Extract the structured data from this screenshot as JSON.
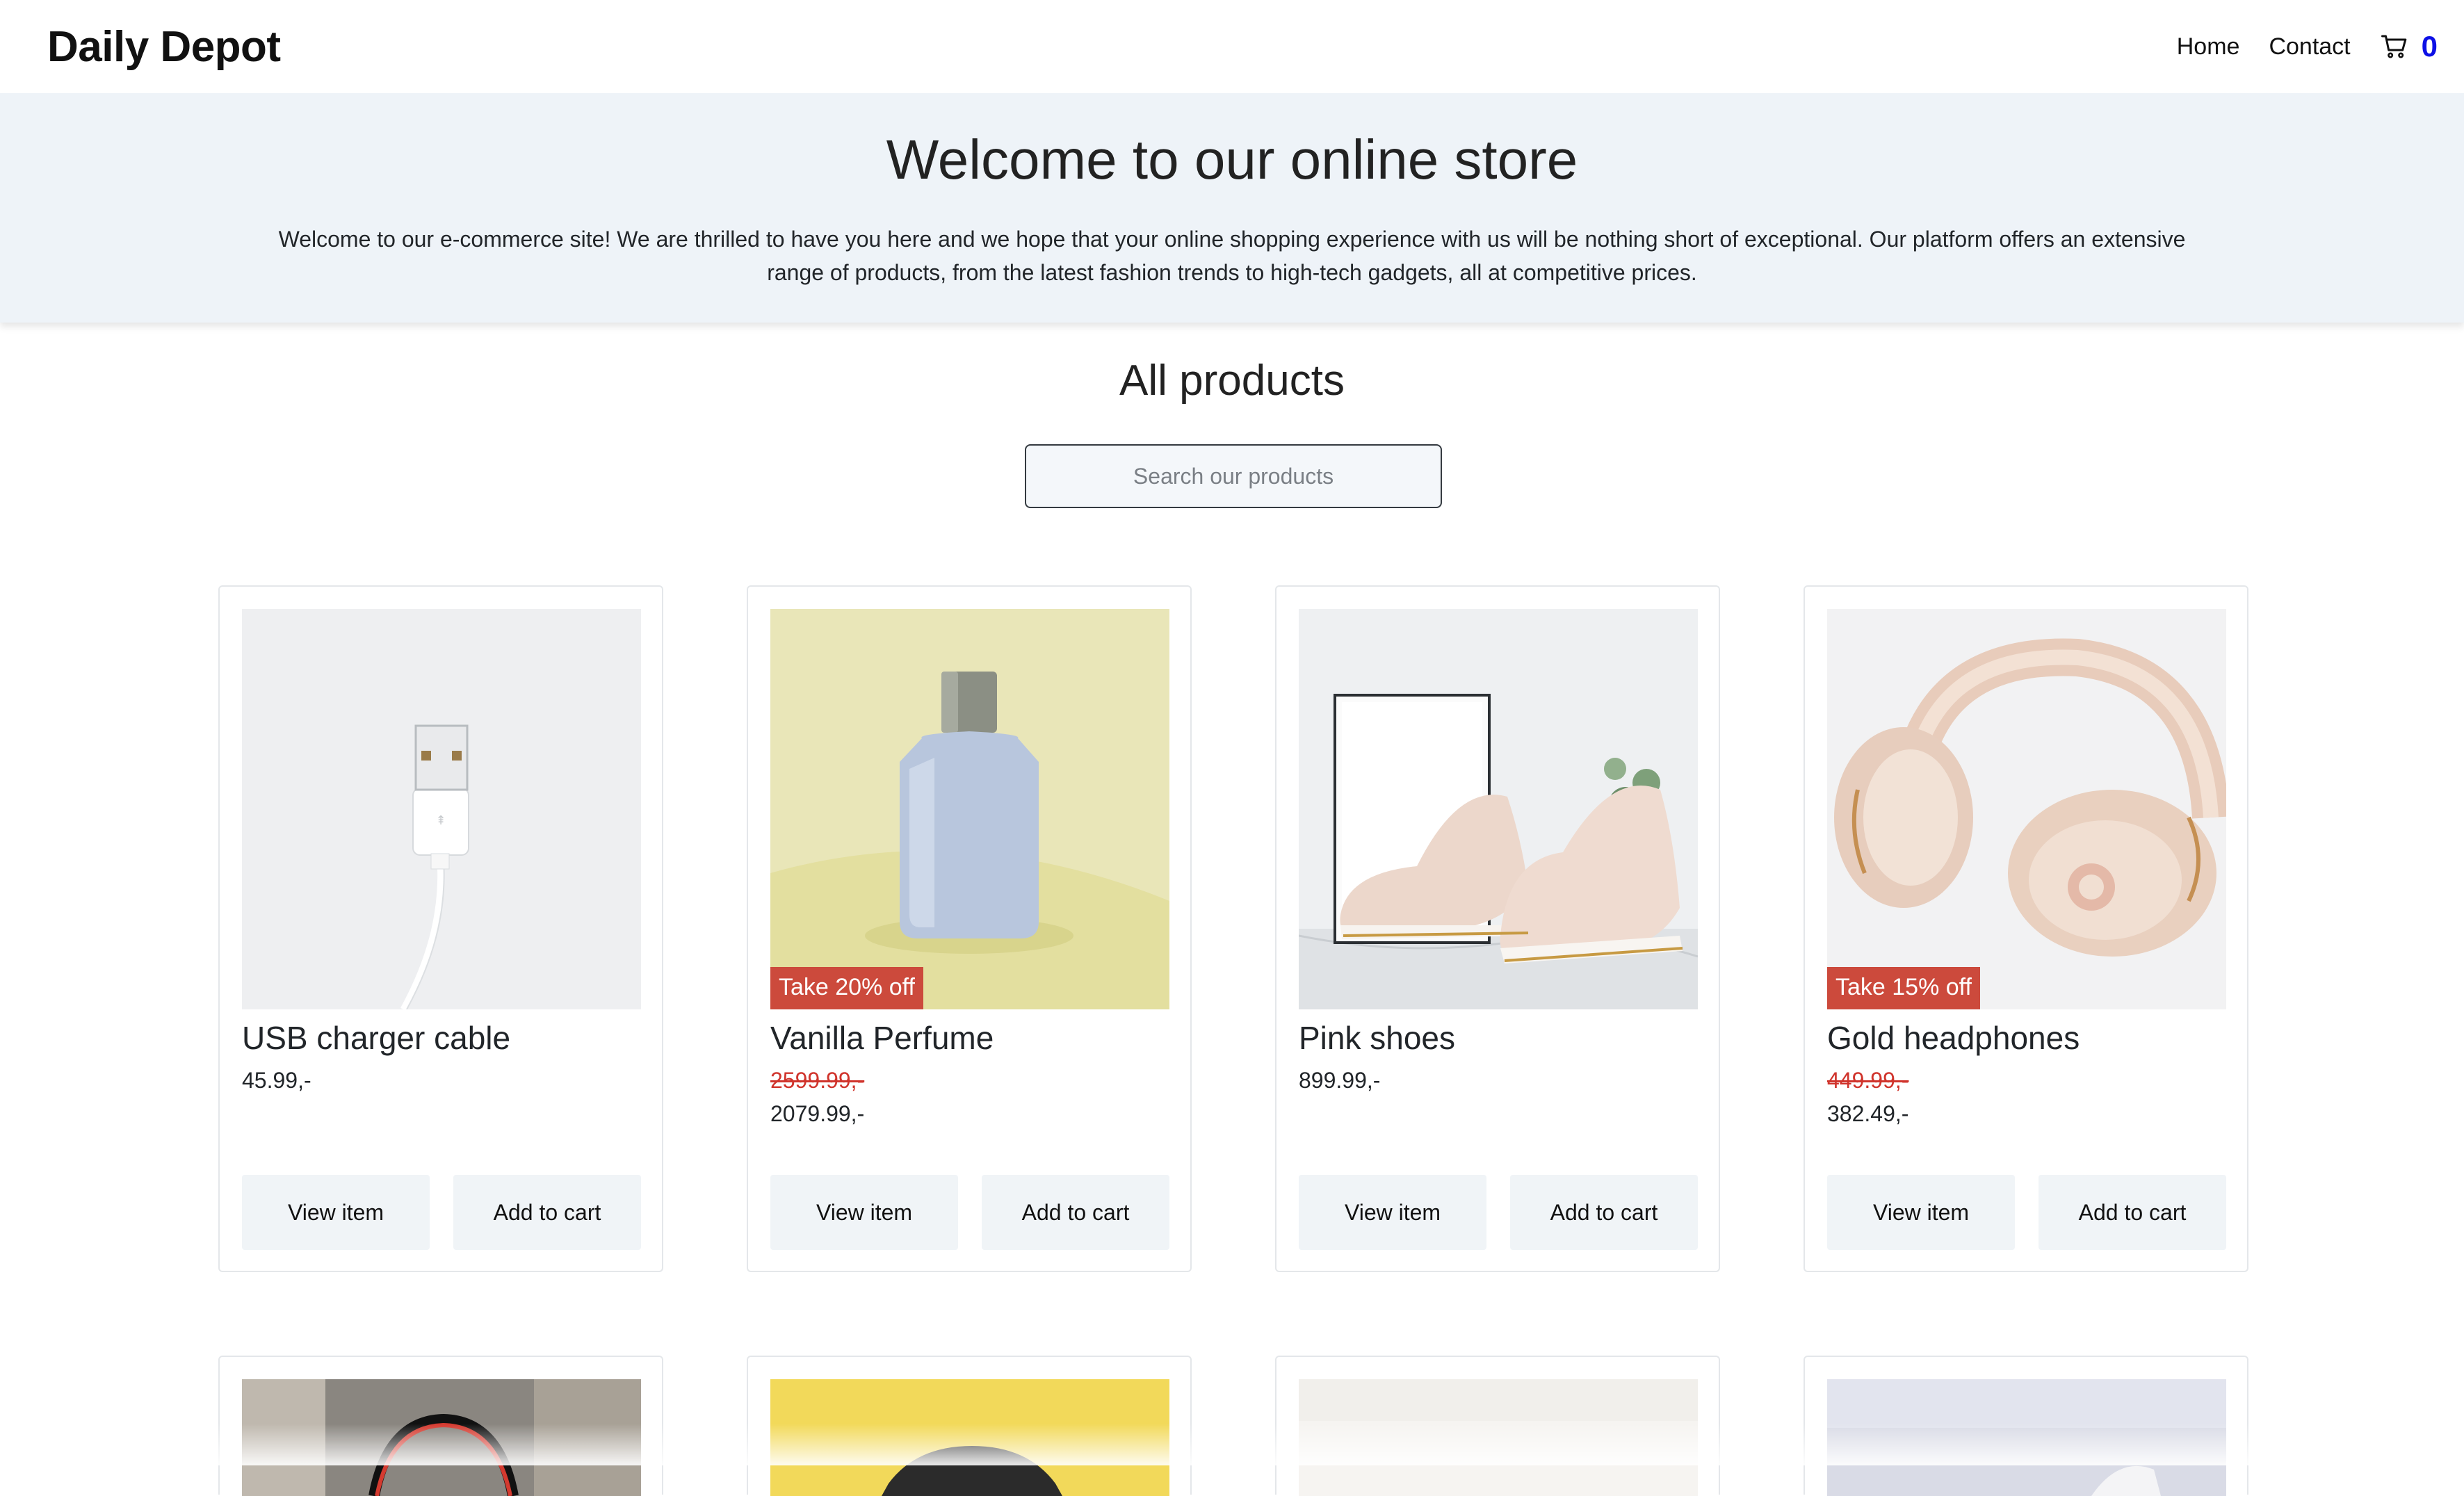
{
  "brand": "Daily Depot",
  "nav": {
    "home": "Home",
    "contact": "Contact",
    "cart_count": "0"
  },
  "hero": {
    "title": "Welcome to our online store",
    "text": "Welcome to our e-commerce site! We are thrilled to have you here and we hope that your online shopping experience with us will be nothing short of exceptional. Our platform offers an extensive range of products, from the latest fashion trends to high-tech gadgets, all at competitive prices."
  },
  "products_section": {
    "title": "All products",
    "search_placeholder": "Search our products"
  },
  "products": [
    {
      "name": "USB charger cable",
      "badge": "",
      "old_price": "",
      "price": "45.99,-",
      "view_label": "View item",
      "add_label": "Add to cart"
    },
    {
      "name": "Vanilla Perfume",
      "badge": "Take 20% off",
      "old_price": "2599.99,-",
      "price": "2079.99,-",
      "view_label": "View item",
      "add_label": "Add to cart"
    },
    {
      "name": "Pink shoes",
      "badge": "",
      "old_price": "",
      "price": "899.99,-",
      "view_label": "View item",
      "add_label": "Add to cart"
    },
    {
      "name": "Gold headphones",
      "badge": "Take 15% off",
      "old_price": "449.99,-",
      "price": "382.49,-",
      "view_label": "View item",
      "add_label": "Add to cart"
    }
  ],
  "colors": {
    "accent": "#0d10e6",
    "badge": "#cc4a3c",
    "strike_price": "#d0342c",
    "hero_background": "#eef3f8",
    "button_background": "#f0f4f7"
  }
}
